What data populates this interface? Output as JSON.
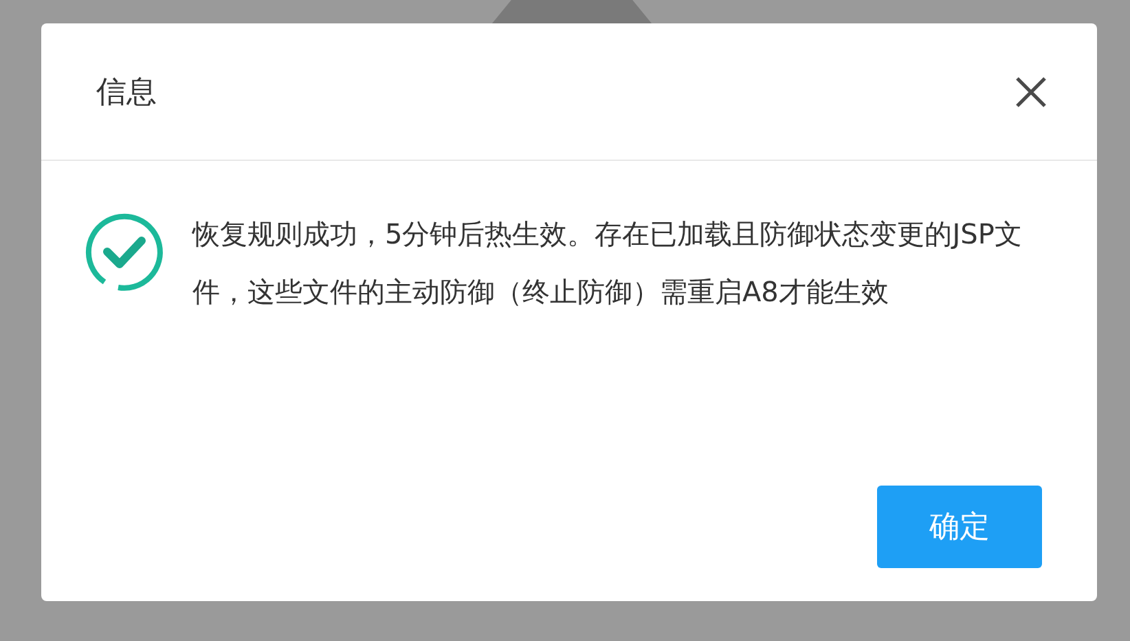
{
  "dialog": {
    "title": "信息",
    "message": "恢复规则成功，5分钟后热生效。存在已加载且防御状态变更的JSP文件，这些文件的主动防御（终止防御）需重启A8才能生效",
    "buttons": [
      "确定"
    ]
  }
}
